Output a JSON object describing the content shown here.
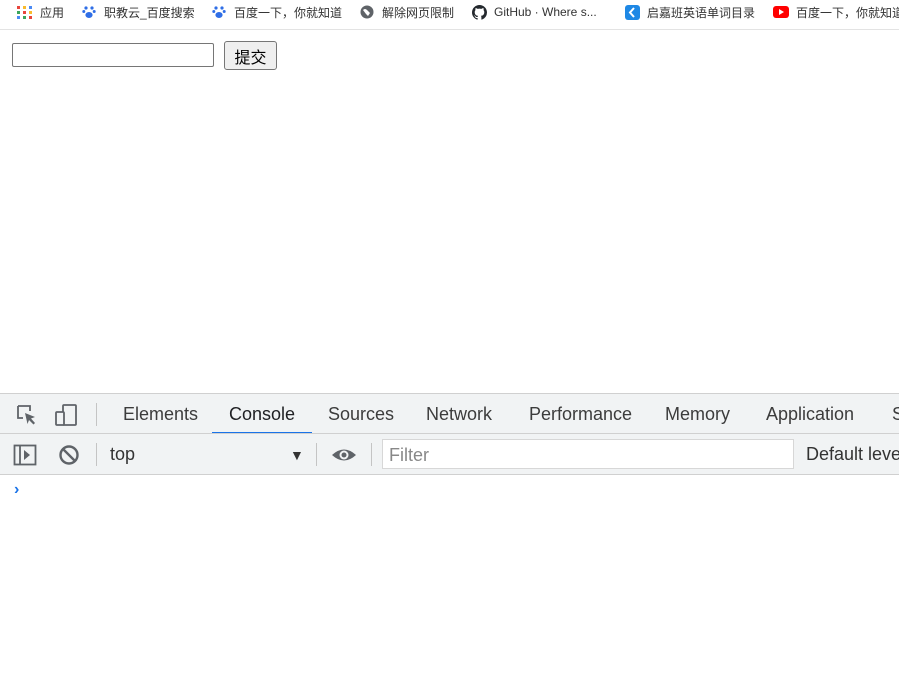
{
  "bookmarks": [
    {
      "label": "应用",
      "icon": "apps-grid-icon"
    },
    {
      "label": "职教云_百度搜索",
      "icon": "baidu-paw-icon"
    },
    {
      "label": "百度一下，你就知道",
      "icon": "baidu-paw-icon"
    },
    {
      "label": "解除网页限制",
      "icon": "globe-icon"
    },
    {
      "label": "GitHub · Where s...",
      "icon": "github-icon"
    },
    {
      "label": "启嘉班英语单词目录",
      "icon": "blue-logo-icon"
    },
    {
      "label": "百度一下，你就知道",
      "icon": "youtube-icon"
    }
  ],
  "page": {
    "input_value": "",
    "submit_label": "提交"
  },
  "devtools": {
    "tabs": [
      "Elements",
      "Console",
      "Sources",
      "Network",
      "Performance",
      "Memory",
      "Application",
      "S"
    ],
    "active_tab": "Console",
    "context": "top",
    "filter_placeholder": "Filter",
    "levels_label": "Default levels",
    "prompt_symbol": "›"
  },
  "colors": {
    "accent": "#1a73e8",
    "toolbar_bg": "#f1f3f4"
  }
}
